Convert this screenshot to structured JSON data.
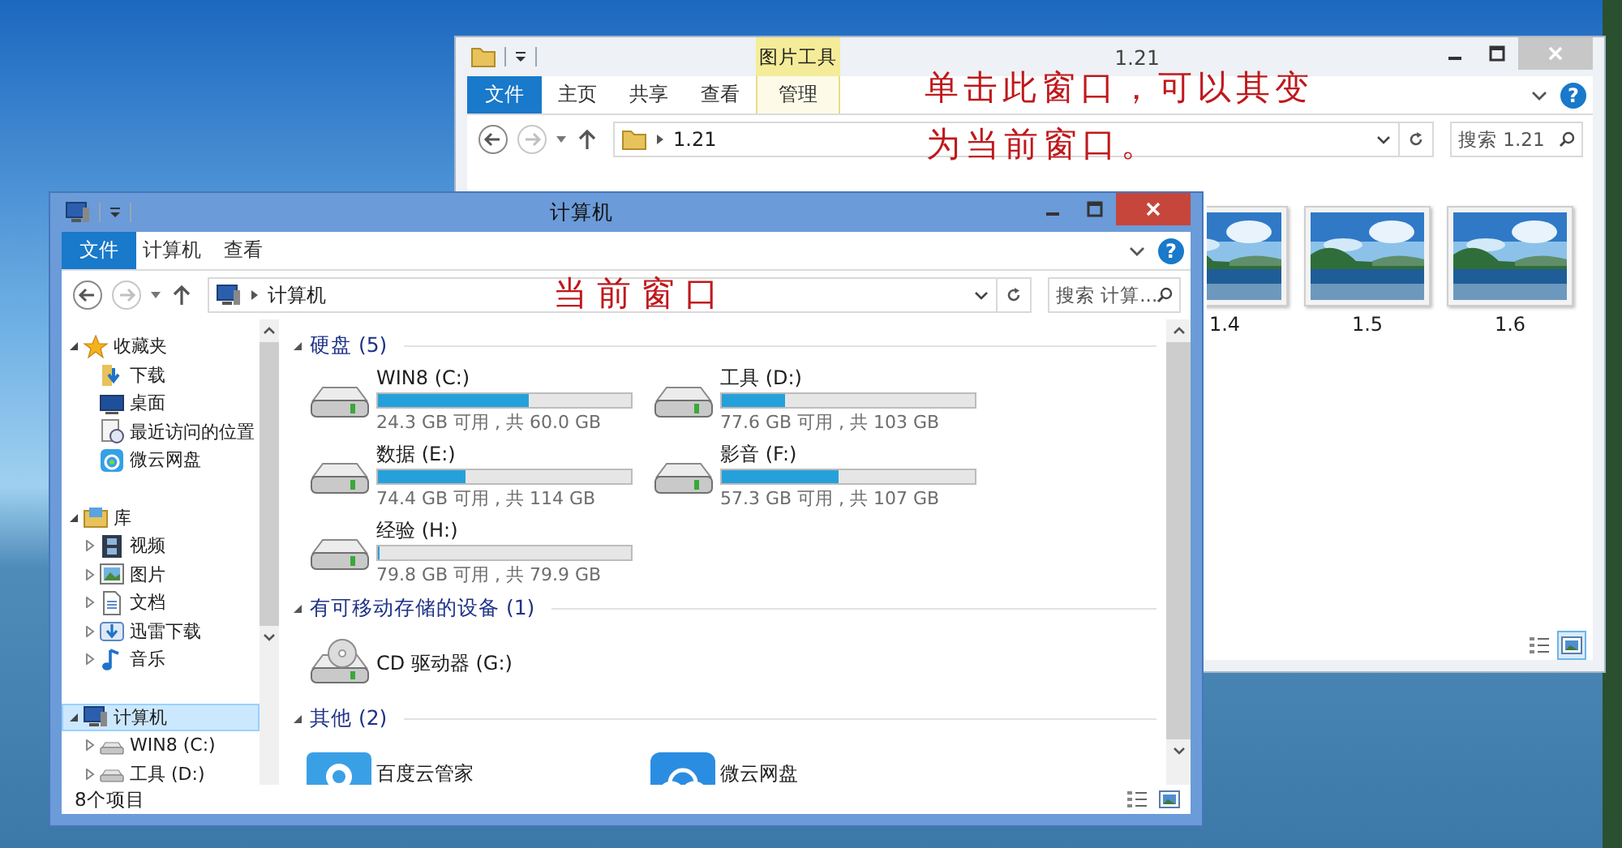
{
  "windows": [
    {
      "title": "1.21",
      "active": false,
      "context_group": "图片工具",
      "tabs": [
        {
          "label": "文件",
          "kind": "file"
        },
        {
          "label": "主页",
          "kind": "tab"
        },
        {
          "label": "共享",
          "kind": "tab"
        },
        {
          "label": "查看",
          "kind": "tab"
        },
        {
          "label": "管理",
          "kind": "contextual"
        }
      ],
      "help": "?",
      "address": {
        "path": "1.21",
        "kind": "folder",
        "note": "为当前窗口。"
      },
      "search": {
        "placeholder": "搜索 1.21"
      },
      "thumbnails": [
        {
          "label": "1.4",
          "kind": "picture"
        },
        {
          "label": "1.5",
          "kind": "picture"
        },
        {
          "label": "1.6",
          "kind": "picture"
        }
      ],
      "view_buttons": [
        {
          "kind": "details",
          "selected": false
        },
        {
          "kind": "large-icons",
          "selected": true
        }
      ]
    },
    {
      "title": "计算机",
      "active": true,
      "tabs": [
        {
          "label": "文件",
          "kind": "file"
        },
        {
          "label": "计算机",
          "kind": "tab"
        },
        {
          "label": "查看",
          "kind": "tab"
        }
      ],
      "help": "?",
      "address": {
        "path": "计算机",
        "kind": "computer",
        "note": "当前窗口"
      },
      "search": {
        "placeholder": "搜索 计算..."
      },
      "tree": [
        {
          "label": "收藏夹",
          "kind": "favorites",
          "expanded": true,
          "selected": false,
          "children": [
            {
              "label": "下载",
              "kind": "downloads",
              "selected": false
            },
            {
              "label": "桌面",
              "kind": "desktop",
              "selected": false
            },
            {
              "label": "最近访问的位置",
              "kind": "recent",
              "selected": false
            },
            {
              "label": "微云网盘",
              "kind": "cloud",
              "selected": false
            }
          ]
        },
        {
          "label": "库",
          "kind": "library",
          "expanded": true,
          "selected": false,
          "children": [
            {
              "label": "视频",
              "kind": "video",
              "expanded": false,
              "selected": false
            },
            {
              "label": "图片",
              "kind": "pictures",
              "expanded": false,
              "selected": false
            },
            {
              "label": "文档",
              "kind": "documents",
              "expanded": false,
              "selected": false
            },
            {
              "label": "迅雷下载",
              "kind": "thunder",
              "expanded": false,
              "selected": false
            },
            {
              "label": "音乐",
              "kind": "music",
              "expanded": false,
              "selected": false
            }
          ]
        },
        {
          "label": "计算机",
          "kind": "computer",
          "expanded": true,
          "selected": true,
          "children": [
            {
              "label": "WIN8 (C:)",
              "kind": "drive",
              "expanded": false,
              "selected": false
            },
            {
              "label": "工具 (D:)",
              "kind": "drive",
              "expanded": false,
              "selected": false
            }
          ]
        }
      ],
      "groups": [
        {
          "title": "硬盘 (5)",
          "expanded": true,
          "items": [
            {
              "kind": "drive",
              "name": "WIN8 (C:)",
              "level": 0.595,
              "info": "24.3 GB 可用 , 共 60.0 GB"
            },
            {
              "kind": "drive",
              "name": "工具 (D:)",
              "level": 0.247,
              "info": "77.6 GB 可用 , 共 103 GB"
            },
            {
              "kind": "drive",
              "name": "数据 (E:)",
              "level": 0.347,
              "info": "74.4 GB 可用 , 共 114 GB"
            },
            {
              "kind": "drive",
              "name": "影音 (F:)",
              "level": 0.464,
              "info": "57.3 GB 可用 , 共 107 GB"
            },
            {
              "kind": "drive",
              "name": "经验 (H:)",
              "level": 0.001,
              "info": "79.8 GB 可用 , 共 79.9 GB"
            }
          ]
        },
        {
          "title": "有可移动存储的设备 (1)",
          "expanded": true,
          "items": [
            {
              "kind": "optical",
              "name": "CD 驱动器 (G:)"
            }
          ]
        },
        {
          "title": "其他 (2)",
          "expanded": true,
          "items": [
            {
              "kind": "app",
              "name": "百度云管家"
            },
            {
              "kind": "app",
              "name": "微云网盘"
            }
          ]
        }
      ],
      "status": "8个项目",
      "view_buttons": [
        {
          "kind": "details",
          "selected": false
        },
        {
          "kind": "tiles",
          "selected": false
        }
      ]
    }
  ],
  "annotations": [
    {
      "text": "单击此窗口，可以其变"
    }
  ]
}
